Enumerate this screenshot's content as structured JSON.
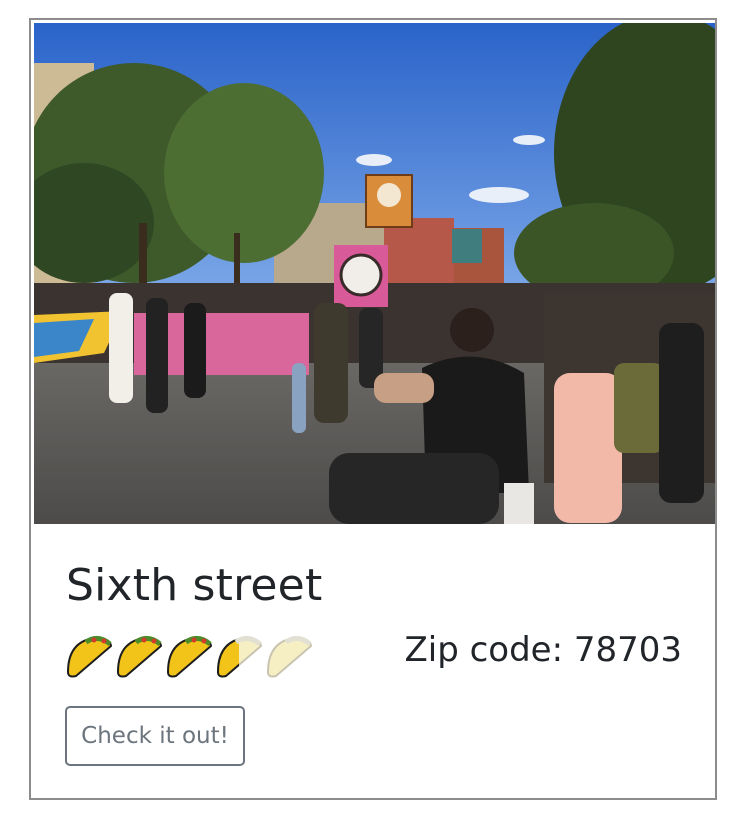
{
  "card": {
    "title": "Sixth street",
    "zip_label": "Zip code: 78703",
    "button_label": "Check it out!",
    "rating": {
      "value": 3.5,
      "max": 5,
      "icon": "taco-icon"
    },
    "photo": {
      "description_icon": "street-parade-photo"
    }
  },
  "colors": {
    "taco_filled": "#f2c318",
    "taco_empty": "#f7efc4",
    "button_border": "#6c757d",
    "title_text": "#212529"
  }
}
